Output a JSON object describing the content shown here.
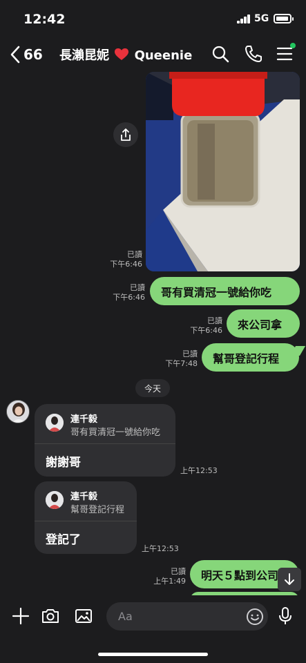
{
  "status_bar": {
    "time": "12:42",
    "network": "5G"
  },
  "header": {
    "back_count": "66",
    "title": "長瀨昆妮",
    "title_suffix": "Queenie"
  },
  "photo_message": {
    "read_label": "已讀",
    "time": "下午6:46"
  },
  "outgoing": [
    {
      "text": "哥有買清冠一號給你吃",
      "read_label": "已讀",
      "time": "下午6:46"
    },
    {
      "text": "來公司拿",
      "read_label": "已讀",
      "time": "下午6:46"
    },
    {
      "text": "幫哥登記行程",
      "read_label": "已讀",
      "time": "下午7:48"
    },
    {
      "text": "明天５點到公司",
      "read_label": "已讀",
      "time": "上午1:49"
    }
  ],
  "date_separator": "今天",
  "incoming": [
    {
      "quote_name": "連千毅",
      "quote_text": "哥有買清冠一號給你吃",
      "text": "謝謝哥",
      "time": "上午12:53"
    },
    {
      "quote_name": "連千毅",
      "quote_text": "幫哥登記行程",
      "text": "登記了",
      "time": "上午12:53"
    }
  ],
  "composer": {
    "placeholder": "Aa"
  },
  "colors": {
    "outgoing_bubble": "#86d67a",
    "background": "#1c1c1e",
    "incoming_bubble": "#2f2f32",
    "online_dot": "#22c55e"
  }
}
